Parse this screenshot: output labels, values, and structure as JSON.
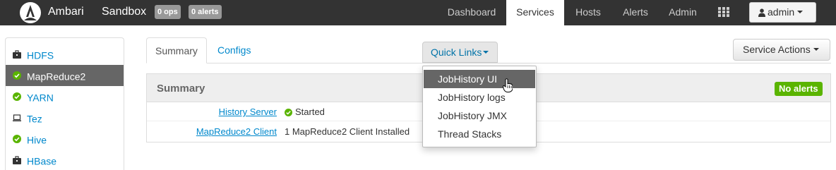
{
  "header": {
    "brand": "Ambari",
    "cluster_name": "Sandbox",
    "ops_badge": "0 ops",
    "alerts_badge": "0 alerts",
    "nav": [
      "Dashboard",
      "Services",
      "Hosts",
      "Alerts",
      "Admin"
    ],
    "active_nav": "Services",
    "views_icon": "grid-icon",
    "user_label": "admin"
  },
  "sidebar": {
    "items": [
      {
        "label": "HDFS",
        "icon": "briefcase-icon"
      },
      {
        "label": "MapReduce2",
        "icon": "check-circle-icon"
      },
      {
        "label": "YARN",
        "icon": "check-circle-icon"
      },
      {
        "label": "Tez",
        "icon": "laptop-icon"
      },
      {
        "label": "Hive",
        "icon": "check-circle-icon"
      },
      {
        "label": "HBase",
        "icon": "briefcase-icon"
      }
    ],
    "active": "MapReduce2"
  },
  "tabs": {
    "summary": "Summary",
    "configs": "Configs",
    "active": "Summary"
  },
  "quick_links": {
    "label": "Quick Links",
    "items": [
      "JobHistory UI",
      "JobHistory logs",
      "JobHistory JMX",
      "Thread Stacks"
    ],
    "hovered": "JobHistory UI"
  },
  "service_actions": {
    "label": "Service Actions"
  },
  "summary_panel": {
    "title": "Summary",
    "alerts_badge": "No alerts",
    "rows": [
      {
        "label": "History Server",
        "value": "Started",
        "status_icon": "check-circle-icon"
      },
      {
        "label": "MapReduce2 Client",
        "value": "1 MapReduce2 Client Installed"
      }
    ]
  },
  "colors": {
    "navbar": "#333333",
    "link": "#0088cc",
    "active_item": "#666666",
    "ok_green": "#5ab400"
  }
}
